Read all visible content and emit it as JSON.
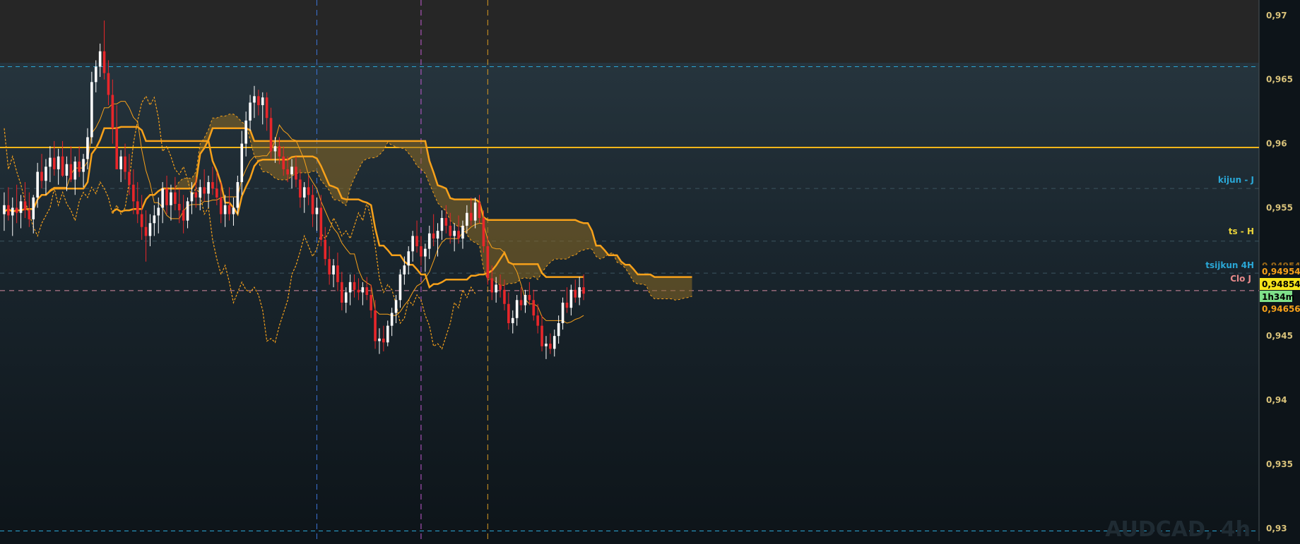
{
  "chart_data": {
    "type": "candlestick",
    "symbol_watermark": "AUDCAD, 4h",
    "ylim": [
      0.929,
      0.9712
    ],
    "y_ticks": [
      "0,97",
      "0,965",
      "0,96",
      "0,955",
      "0,95",
      "0,945",
      "0,94",
      "0,935",
      "0,93"
    ],
    "y_tick_values": [
      0.97,
      0.965,
      0.96,
      0.955,
      0.95,
      0.945,
      0.94,
      0.935,
      0.93
    ],
    "n_slots": 202,
    "colors": {
      "bull": "#ffffff",
      "bear": "#e8262a",
      "ichimoku": "#f7a11a",
      "cloud_fill": "#8a6a25",
      "grid_cyan": "#2aa7d6",
      "blue_vline": "#3c74d8",
      "magenta_vline": "#c35bd1",
      "orange_vline": "#d99a22",
      "price_axis_text": "#d8c27a"
    },
    "candles": [
      [
        0.9545,
        0.9562,
        0.9532,
        0.9552
      ],
      [
        0.9552,
        0.9566,
        0.954,
        0.9544
      ],
      [
        0.9544,
        0.9558,
        0.9528,
        0.955
      ],
      [
        0.955,
        0.9568,
        0.9538,
        0.9546
      ],
      [
        0.9546,
        0.956,
        0.9534,
        0.9555
      ],
      [
        0.9555,
        0.957,
        0.9542,
        0.9548
      ],
      [
        0.9548,
        0.9562,
        0.9535,
        0.9541
      ],
      [
        0.9541,
        0.956,
        0.953,
        0.9558
      ],
      [
        0.9558,
        0.9585,
        0.955,
        0.9578
      ],
      [
        0.9578,
        0.9592,
        0.9565,
        0.9571
      ],
      [
        0.9571,
        0.9588,
        0.956,
        0.9582
      ],
      [
        0.9582,
        0.9598,
        0.957,
        0.9589
      ],
      [
        0.9589,
        0.9602,
        0.9575,
        0.958
      ],
      [
        0.958,
        0.9596,
        0.9568,
        0.959
      ],
      [
        0.959,
        0.9602,
        0.9574,
        0.9575
      ],
      [
        0.9575,
        0.959,
        0.9563,
        0.9584
      ],
      [
        0.9584,
        0.9598,
        0.957,
        0.9572
      ],
      [
        0.9572,
        0.959,
        0.956,
        0.9586
      ],
      [
        0.9586,
        0.9598,
        0.9574,
        0.9578
      ],
      [
        0.9578,
        0.9592,
        0.9566,
        0.9588
      ],
      [
        0.9588,
        0.9612,
        0.958,
        0.9605
      ],
      [
        0.9605,
        0.9656,
        0.96,
        0.9648
      ],
      [
        0.9648,
        0.9665,
        0.964,
        0.966
      ],
      [
        0.966,
        0.9678,
        0.9652,
        0.9672
      ],
      [
        0.9672,
        0.9696,
        0.965,
        0.9655
      ],
      [
        0.9655,
        0.9665,
        0.963,
        0.9638
      ],
      [
        0.9638,
        0.965,
        0.96,
        0.9612
      ],
      [
        0.9612,
        0.963,
        0.959,
        0.958
      ],
      [
        0.958,
        0.9595,
        0.957,
        0.959
      ],
      [
        0.959,
        0.96,
        0.9572,
        0.9578
      ],
      [
        0.9578,
        0.9592,
        0.956,
        0.9568
      ],
      [
        0.9568,
        0.958,
        0.9545,
        0.9555
      ],
      [
        0.9555,
        0.957,
        0.9538,
        0.9545
      ],
      [
        0.9545,
        0.956,
        0.9525,
        0.9535
      ],
      [
        0.9535,
        0.9548,
        0.9508,
        0.9528
      ],
      [
        0.9528,
        0.9545,
        0.952,
        0.9538
      ],
      [
        0.9538,
        0.9552,
        0.9528,
        0.9544
      ],
      [
        0.9544,
        0.9558,
        0.953,
        0.955
      ],
      [
        0.955,
        0.957,
        0.9538,
        0.9565
      ],
      [
        0.9565,
        0.9575,
        0.9545,
        0.9552
      ],
      [
        0.9552,
        0.9568,
        0.954,
        0.9562
      ],
      [
        0.9562,
        0.9574,
        0.9548,
        0.9553
      ],
      [
        0.9553,
        0.9565,
        0.9538,
        0.9548
      ],
      [
        0.9548,
        0.956,
        0.953,
        0.954
      ],
      [
        0.954,
        0.9558,
        0.9534,
        0.9555
      ],
      [
        0.9555,
        0.957,
        0.9545,
        0.9562
      ],
      [
        0.9562,
        0.9574,
        0.955,
        0.9558
      ],
      [
        0.9558,
        0.9572,
        0.9548,
        0.9566
      ],
      [
        0.9566,
        0.958,
        0.9555,
        0.9561
      ],
      [
        0.9561,
        0.9575,
        0.955,
        0.957
      ],
      [
        0.957,
        0.9582,
        0.956,
        0.9565
      ],
      [
        0.9565,
        0.9578,
        0.9552,
        0.9558
      ],
      [
        0.9558,
        0.957,
        0.9538,
        0.9545
      ],
      [
        0.9545,
        0.956,
        0.9535,
        0.9552
      ],
      [
        0.9552,
        0.9566,
        0.954,
        0.9545
      ],
      [
        0.9545,
        0.9558,
        0.9536,
        0.955
      ],
      [
        0.955,
        0.9575,
        0.9545,
        0.957
      ],
      [
        0.957,
        0.961,
        0.956,
        0.96
      ],
      [
        0.96,
        0.9625,
        0.959,
        0.9618
      ],
      [
        0.9618,
        0.9638,
        0.961,
        0.9632
      ],
      [
        0.9632,
        0.9645,
        0.962,
        0.9637
      ],
      [
        0.9637,
        0.9642,
        0.9622,
        0.963
      ],
      [
        0.963,
        0.964,
        0.9615,
        0.9636
      ],
      [
        0.9636,
        0.964,
        0.961,
        0.962
      ],
      [
        0.962,
        0.9628,
        0.9588,
        0.9594
      ],
      [
        0.9594,
        0.9605,
        0.9585,
        0.9598
      ],
      [
        0.9598,
        0.9605,
        0.9584,
        0.959
      ],
      [
        0.959,
        0.9598,
        0.9575,
        0.958
      ],
      [
        0.958,
        0.959,
        0.957,
        0.9576
      ],
      [
        0.9576,
        0.9588,
        0.9565,
        0.9582
      ],
      [
        0.9582,
        0.959,
        0.9566,
        0.9572
      ],
      [
        0.9572,
        0.958,
        0.955,
        0.9558
      ],
      [
        0.9558,
        0.957,
        0.9546,
        0.9566
      ],
      [
        0.9566,
        0.9575,
        0.9552,
        0.956
      ],
      [
        0.956,
        0.9568,
        0.9535,
        0.9545
      ],
      [
        0.9545,
        0.9558,
        0.9532,
        0.955
      ],
      [
        0.955,
        0.956,
        0.952,
        0.9525
      ],
      [
        0.9525,
        0.9535,
        0.9505,
        0.951
      ],
      [
        0.951,
        0.952,
        0.949,
        0.9498
      ],
      [
        0.9498,
        0.951,
        0.9488,
        0.9505
      ],
      [
        0.9505,
        0.9515,
        0.9485,
        0.9492
      ],
      [
        0.9492,
        0.95,
        0.947,
        0.9476
      ],
      [
        0.9476,
        0.9488,
        0.9468,
        0.9484
      ],
      [
        0.9484,
        0.9498,
        0.9474,
        0.9492
      ],
      [
        0.9492,
        0.9498,
        0.948,
        0.9486
      ],
      [
        0.9486,
        0.9495,
        0.9478,
        0.9484
      ],
      [
        0.9484,
        0.9492,
        0.9474,
        0.9488
      ],
      [
        0.9488,
        0.9496,
        0.9478,
        0.9482
      ],
      [
        0.9482,
        0.949,
        0.9464,
        0.947
      ],
      [
        0.947,
        0.9478,
        0.944,
        0.9446
      ],
      [
        0.9446,
        0.9456,
        0.9436,
        0.9448
      ],
      [
        0.9448,
        0.9458,
        0.9438,
        0.9445
      ],
      [
        0.9445,
        0.9462,
        0.9442,
        0.9458
      ],
      [
        0.9458,
        0.9472,
        0.945,
        0.9468
      ],
      [
        0.9468,
        0.9482,
        0.946,
        0.9478
      ],
      [
        0.9478,
        0.9502,
        0.9472,
        0.9498
      ],
      [
        0.9498,
        0.9512,
        0.949,
        0.9505
      ],
      [
        0.9505,
        0.952,
        0.9498,
        0.9516
      ],
      [
        0.9516,
        0.9532,
        0.9508,
        0.9528
      ],
      [
        0.9528,
        0.954,
        0.9515,
        0.952
      ],
      [
        0.952,
        0.9528,
        0.9505,
        0.9512
      ],
      [
        0.9512,
        0.9522,
        0.95,
        0.9518
      ],
      [
        0.9518,
        0.9536,
        0.951,
        0.953
      ],
      [
        0.953,
        0.9545,
        0.952,
        0.9526
      ],
      [
        0.9526,
        0.9538,
        0.9512,
        0.9532
      ],
      [
        0.9532,
        0.9548,
        0.9525,
        0.9542
      ],
      [
        0.9542,
        0.9552,
        0.953,
        0.9536
      ],
      [
        0.9536,
        0.9546,
        0.9522,
        0.9528
      ],
      [
        0.9528,
        0.9538,
        0.9516,
        0.9532
      ],
      [
        0.9532,
        0.9544,
        0.9522,
        0.9526
      ],
      [
        0.9526,
        0.954,
        0.9518,
        0.9536
      ],
      [
        0.9536,
        0.9552,
        0.953,
        0.9546
      ],
      [
        0.9546,
        0.9558,
        0.9536,
        0.954
      ],
      [
        0.954,
        0.9558,
        0.9534,
        0.9554
      ],
      [
        0.9554,
        0.956,
        0.9538,
        0.9542
      ],
      [
        0.9542,
        0.9548,
        0.9515,
        0.952
      ],
      [
        0.952,
        0.9528,
        0.949,
        0.9495
      ],
      [
        0.9495,
        0.9505,
        0.9478,
        0.9484
      ],
      [
        0.9484,
        0.9496,
        0.9476,
        0.949
      ],
      [
        0.949,
        0.9498,
        0.948,
        0.9486
      ],
      [
        0.9486,
        0.9494,
        0.947,
        0.9475
      ],
      [
        0.9475,
        0.9484,
        0.9455,
        0.946
      ],
      [
        0.946,
        0.947,
        0.9452,
        0.9464
      ],
      [
        0.9464,
        0.9482,
        0.9458,
        0.9478
      ],
      [
        0.9478,
        0.9488,
        0.947,
        0.9474
      ],
      [
        0.9474,
        0.9486,
        0.9468,
        0.9482
      ],
      [
        0.9482,
        0.9492,
        0.9474,
        0.9478
      ],
      [
        0.9478,
        0.9486,
        0.9462,
        0.9466
      ],
      [
        0.9466,
        0.9475,
        0.9452,
        0.9458
      ],
      [
        0.9458,
        0.9466,
        0.9438,
        0.9442
      ],
      [
        0.9442,
        0.945,
        0.9432,
        0.9444
      ],
      [
        0.9444,
        0.9452,
        0.9436,
        0.944
      ],
      [
        0.944,
        0.9455,
        0.9434,
        0.945
      ],
      [
        0.945,
        0.9466,
        0.9444,
        0.946
      ],
      [
        0.946,
        0.948,
        0.9455,
        0.9476
      ],
      [
        0.9476,
        0.9488,
        0.9468,
        0.9472
      ],
      [
        0.9472,
        0.949,
        0.9466,
        0.9486
      ],
      [
        0.9486,
        0.9494,
        0.9476,
        0.948
      ],
      [
        0.948,
        0.9496,
        0.9474,
        0.9488
      ],
      [
        0.9488,
        0.9498,
        0.9478,
        0.9483
      ]
    ]
  },
  "ichimoku_lines": {
    "kijun_label": "kijun - J",
    "ts_label": "ts - H",
    "kijun4h_label": "tsijkun 4H",
    "clo_label": "Clo J"
  },
  "horizontal_levels": {
    "cyan_top": 0.966,
    "cyan_bottom": 0.9298,
    "yellow_main": 0.9597,
    "kijun_j": 0.9565,
    "ts_h": 0.9524,
    "kijun_4h": 0.9499,
    "clo_j": 0.94854
  },
  "price_tags": {
    "tag1": "0,949545",
    "tag1_partial": "0,949545",
    "tag2": "0,948541",
    "timer": "1h34m",
    "tag3": "0,946560"
  },
  "price_tag_colors": {
    "tag1_bg": "#0d1419",
    "tag1_fg": "#f7a11a",
    "tag2_bg": "#f6e51b",
    "tag2_fg": "#000000",
    "timer_bg": "#7ee08a",
    "timer_fg": "#000000",
    "tag3_bg": "#0d1419",
    "tag3_fg": "#f7a11a"
  },
  "vertical_markers": {
    "blue_slot": 75,
    "magenta_slot": 100,
    "orange_slot": 116
  }
}
